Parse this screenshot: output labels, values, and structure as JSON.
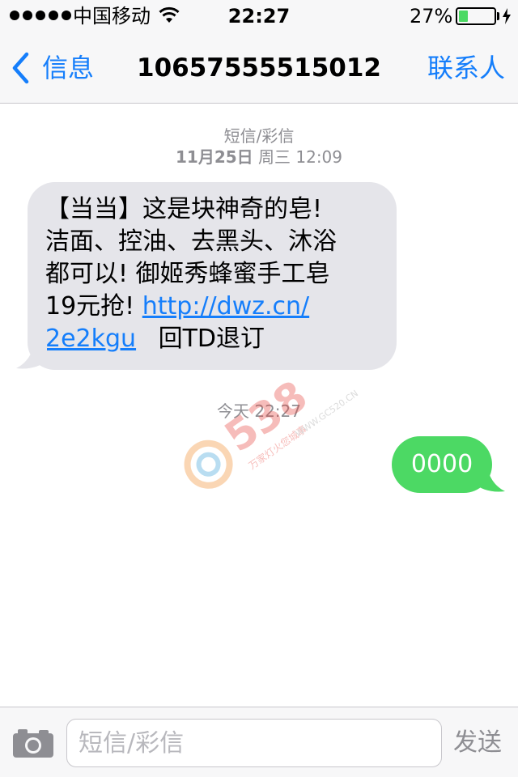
{
  "status_bar": {
    "carrier": "中国移动",
    "time": "22:27",
    "battery_percent": "27%",
    "battery_level": 0.27,
    "signal_bars": 5
  },
  "nav": {
    "back_label": "信息",
    "title": "10657555515012",
    "contact_label": "联系人"
  },
  "conversation": {
    "message_type": "短信/彩信",
    "first_date": "11月25日",
    "first_weekday_time": "周三 12:09",
    "incoming": {
      "line1": "【当当】这是块神奇的皂!",
      "line2": "洁面、控油、去黑头、沐浴",
      "line3": "都可以! 御姬秀蜂蜜手工皂",
      "line4_text": "19元抢! ",
      "link_part1": "http://dwz.cn/",
      "link_part2": "2e2kgu",
      "line5_suffix": "回TD退订"
    },
    "second_time": "今天 22:27",
    "outgoing": {
      "text": "0000"
    }
  },
  "watermark": {
    "brand": "538",
    "url": "WWW.GC520.CN",
    "slogan": "万家灯火您城事"
  },
  "input_bar": {
    "placeholder": "短信/彩信",
    "value": "",
    "send_label": "发送"
  },
  "colors": {
    "accent": "#157efb",
    "incoming_bubble": "#e5e5ea",
    "outgoing_bubble": "#4cd964",
    "meta_text": "#8e8e93"
  }
}
